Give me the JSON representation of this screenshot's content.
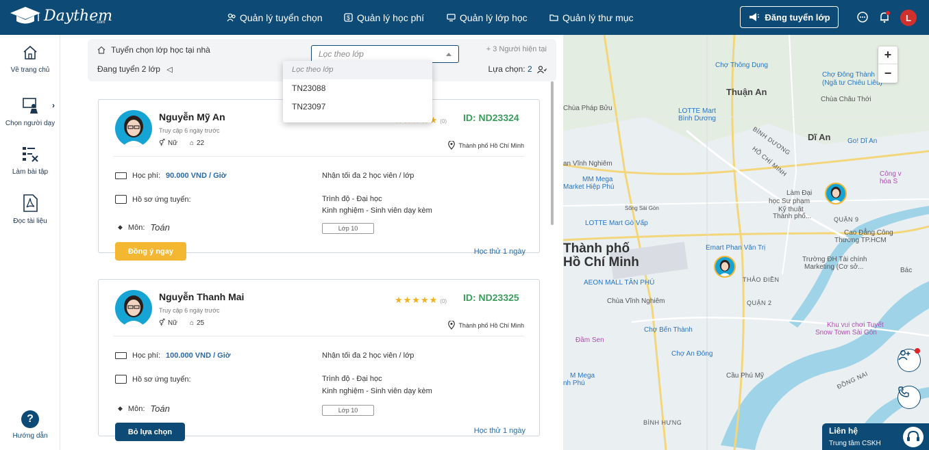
{
  "brand": {
    "name": "Daythem",
    "sub": ".com"
  },
  "nav": [
    {
      "label": "Quản lý tuyển chọn"
    },
    {
      "label": "Quản lý học phí"
    },
    {
      "label": "Quản lý lớp học"
    },
    {
      "label": "Quản lý thư mục"
    }
  ],
  "header": {
    "post_button": "Đăng tuyển lớp",
    "avatar_initial": "L"
  },
  "sidebar": {
    "items": [
      {
        "label": "Về trang chủ"
      },
      {
        "label": "Chọn người dạy"
      },
      {
        "label": "Làm bài tập"
      },
      {
        "label": "Đọc tài liệu"
      }
    ],
    "help": {
      "icon": "?",
      "label": "Hướng dẫn"
    }
  },
  "filter": {
    "title": "Tuyển chọn lớp học tại nhà",
    "select_placeholder": "Lọc theo lớp",
    "options": [
      "Lọc theo lớp",
      "TN23088",
      "TN23097"
    ],
    "online": "+ 3 Người hiện tại",
    "recruiting": "Đang tuyển 2 lớp",
    "choice_label": "Lựa chọn:",
    "choice_count": "2"
  },
  "tutors": [
    {
      "name": "Nguyễn Mỹ An",
      "access": "Truy cập 6 ngày trước",
      "gender": "Nữ",
      "age": "22",
      "stars": "★★★★★",
      "rating": "(0)",
      "id": "ID: ND23324",
      "location": "Thành phố Hồ Chí Minh",
      "fee_label": "Học phí:",
      "fee_value": "90.000 VND / Giờ",
      "capacity": "Nhận tối đa 2 học viên / lớp",
      "profile_label": "Hồ sơ ứng tuyển:",
      "level": "Trình độ - Đại học",
      "experience": "Kinh nghiệm - Sinh viên dạy kèm",
      "subject_label": "Môn:",
      "subject_value": "Toán",
      "class_tag": "Lớp 10",
      "action": "Đồng ý ngay",
      "trial": "Học thử 1 ngày"
    },
    {
      "name": "Nguyễn Thanh Mai",
      "access": "Truy cập 6 ngày trước",
      "gender": "Nữ",
      "age": "25",
      "stars": "★★★★★",
      "rating": "(0)",
      "id": "ID: ND23325",
      "location": "Thành phố Hồ Chí Minh",
      "fee_label": "Học phí:",
      "fee_value": "100.000 VND / Giờ",
      "capacity": "Nhận tối đa 2 học viên / lớp",
      "profile_label": "Hồ sơ ứng tuyển:",
      "level": "Trình độ - Đại học",
      "experience": "Kinh nghiệm - Sinh viên dạy kèm",
      "subject_label": "Môn:",
      "subject_value": "Toán",
      "class_tag": "Lớp 10",
      "action": "Bỏ lựa chọn",
      "trial": "Học thử 1 ngày"
    }
  ],
  "map": {
    "zoom_in": "+",
    "zoom_out": "−",
    "labels": {
      "thuan_an": "Thuận An",
      "di_an": "Dĩ An",
      "hcm1": "Thành phố",
      "hcm2": "Hồ Chí Minh",
      "cho_thong_dung": "Chợ Thông Dụng",
      "cho_dong_thanh": "Chợ Đông Thành",
      "ngatu": "(Ngã tư Chiêu Liêu)",
      "chua_chau_thoi": "Chùa Châu Thới",
      "chua_phap_buu": "Chùa Pháp Bửu",
      "lotte_mart_binh_duong1": "LOTTE Mart",
      "lotte_mart_binh_duong2": "Bình Dương",
      "an_vinh_nghiem": "an Vĩnh Nghiêm",
      "mm_mega1": "MM Mega",
      "mm_mega2": "Market Hiệp Phú",
      "go_di_an": "Go! Dĩ An",
      "lam_dai1": "Làm Đại",
      "lam_dai2": "học Sư phạm",
      "lam_dai3": "Kỹ thuật",
      "lam_dai4": "Thành phố...",
      "lotte_govap": "LOTTE Mart Gò Vấp",
      "emart": "Emart Phan Văn Trị",
      "aeon": "AEON MALL TÂN PHÚ",
      "chua_vinh_nghiem": "Chùa Vĩnh Nghiêm",
      "cao_dang1": "Cao Đẳng Công",
      "cao_dang2": "Thương TP.HCM",
      "truong_dh1": "Trường ĐH Tài chính",
      "truong_dh2": "Marketing (Cơ sở...",
      "dam_sen": "Đầm Sen",
      "cho_ben_thanh": "Chợ Bến Thành",
      "khu_vui_choi1": "Khu vui chơi Tuyết",
      "khu_vui_choi2": "Snow Town Sài Gòn",
      "cho_an_dong": "Chợ An Đông",
      "mm_mega_an_phu1": "M Mega",
      "mm_mega_an_phu2": "nh Phú",
      "cau_phu_my": "Cầu Phú Mỹ",
      "binh_hung": "BÌNH HƯNG",
      "binh_duong": "BÌNH DƯƠNG",
      "ho_chi_minh_caps": "HỒ CHÍ MINH",
      "quan_9": "QUẬN 9",
      "quan_2": "QUẬN 2",
      "thao_dien": "THẢO ĐIỀN",
      "dong_nai": "ĐỒNG NAI",
      "cong_vien1": "Công v",
      "cong_vien2": "hóa S",
      "bac": "Bác",
      "song_sai_gon": "Sông Sài Gòn"
    }
  },
  "contact": {
    "title": "Liên hệ",
    "subtitle": "Trung tâm CSKH"
  },
  "colors": {
    "primary": "#0d4a75",
    "accent": "#f3b731",
    "id": "#3a9b5b",
    "fee": "#2a6aa8"
  }
}
